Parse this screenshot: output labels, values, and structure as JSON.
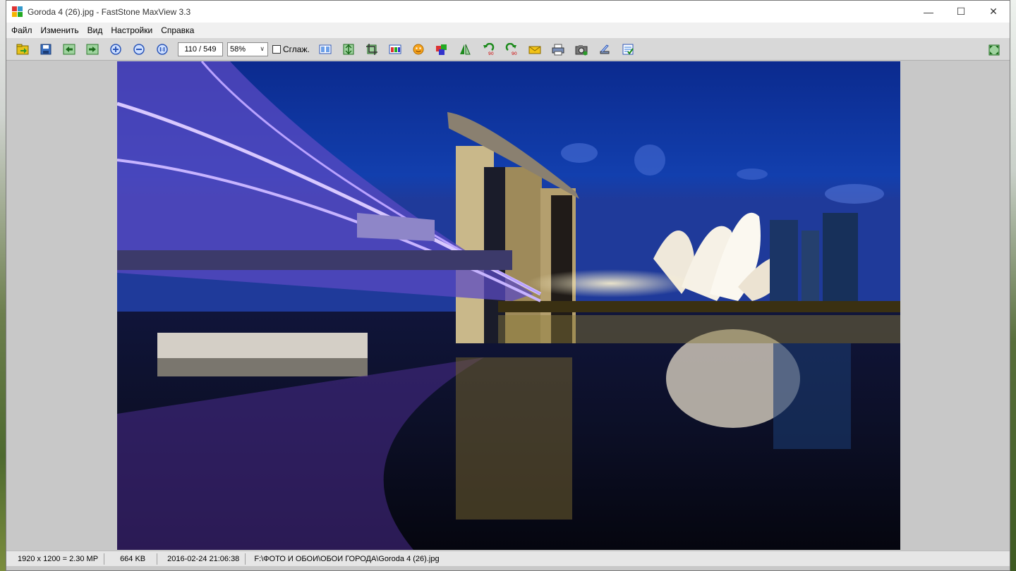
{
  "window": {
    "title": "Goroda 4  (26).jpg - FastStone MaxView 3.3",
    "minimize_glyph": "—",
    "maximize_glyph": "☐",
    "close_glyph": "✕"
  },
  "menu": {
    "items": [
      "Файл",
      "Изменить",
      "Вид",
      "Настройки",
      "Справка"
    ]
  },
  "toolbar": {
    "icons_left": [
      "open-folder-icon",
      "save-icon",
      "previous-icon",
      "next-icon",
      "zoom-in-icon",
      "zoom-out-icon",
      "actual-size-icon"
    ],
    "page_counter": "110 / 549",
    "zoom_value": "58%",
    "smooth_label": "Сглаж.",
    "smooth_checked": false,
    "icons_right": [
      "slideshow-icon",
      "resize-icon",
      "crop-icon",
      "color-adjust-icon",
      "red-eye-icon",
      "effects-icon",
      "flip-icon",
      "rotate-left-icon",
      "rotate-right-icon",
      "email-icon",
      "print-icon",
      "capture-icon",
      "scanner-icon",
      "settings-icon"
    ],
    "fullscreen_icon": "fullscreen-icon"
  },
  "status": {
    "dimensions": "1920 x 1200 = 2.30 MP",
    "size": "664 KB",
    "date": "2016-02-24 21:06:38",
    "path": "F:\\ФОТО И ОБОИ\\ОБОИ ГОРОДА\\Goroda 4  (26).jpg"
  }
}
